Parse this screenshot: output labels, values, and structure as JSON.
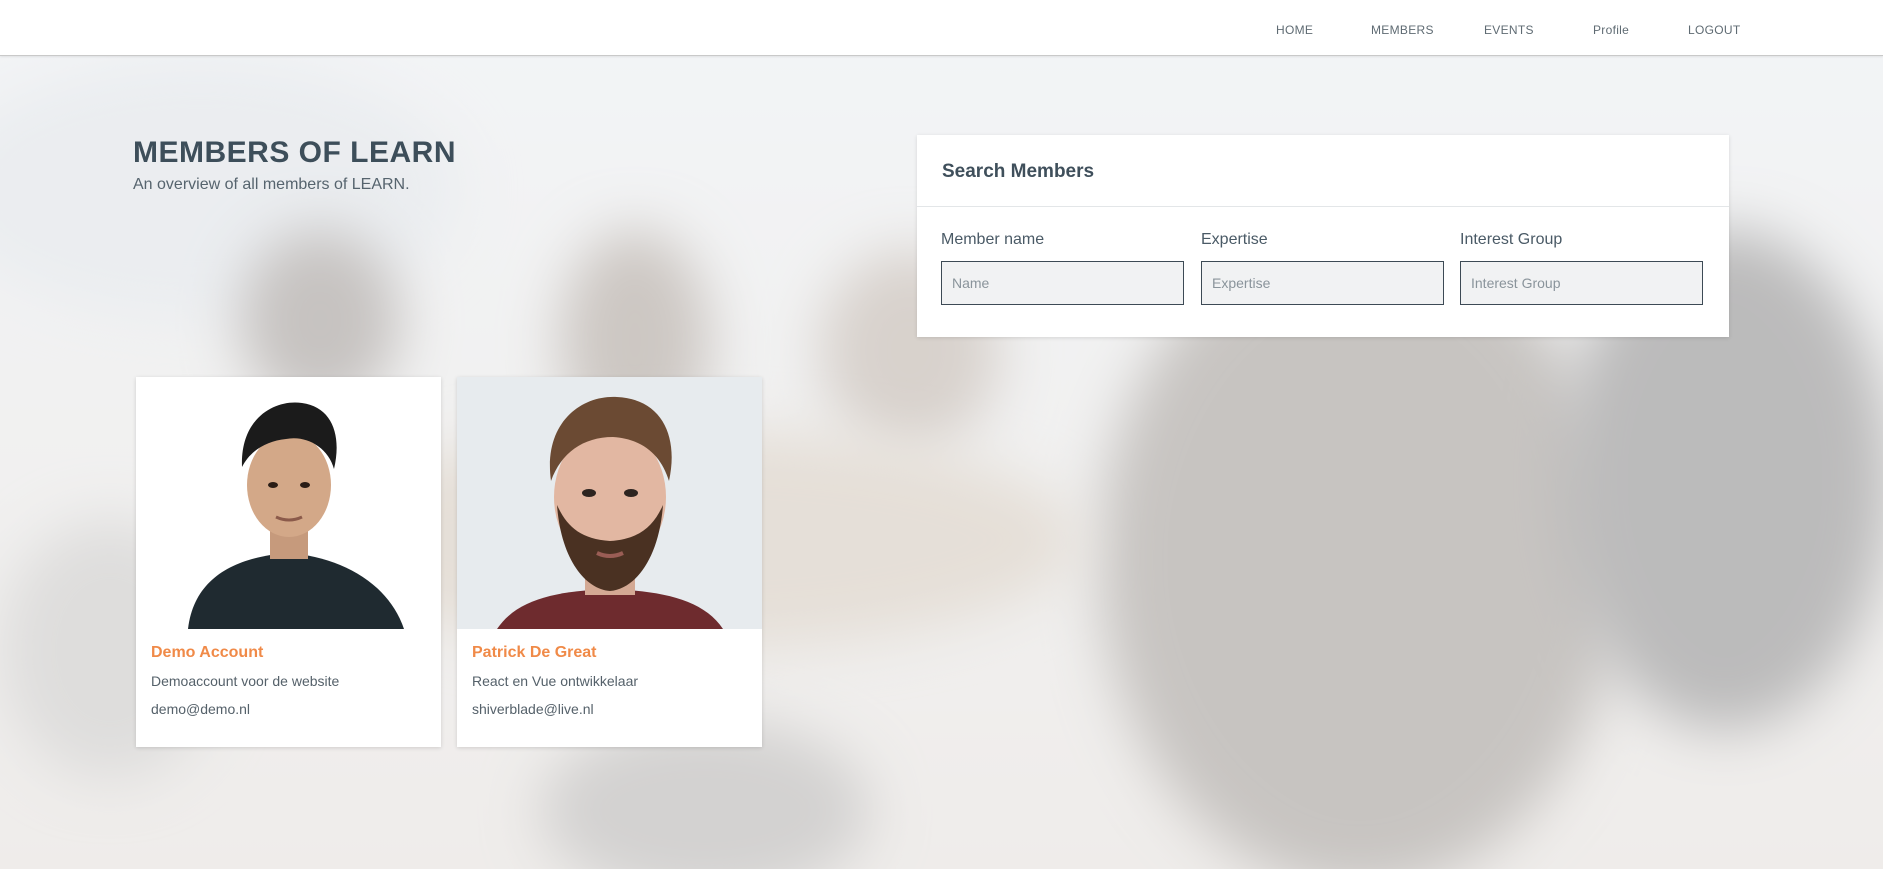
{
  "nav": {
    "items": [
      "HOME",
      "MEMBERS",
      "EVENTS",
      "Profile",
      "LOGOUT"
    ]
  },
  "page": {
    "title": "MEMBERS OF LEARN",
    "subtitle": "An overview of all members of LEARN."
  },
  "search": {
    "title": "Search Members",
    "fields": [
      {
        "label": "Member name",
        "placeholder": "Name",
        "value": ""
      },
      {
        "label": "Expertise",
        "placeholder": "Expertise",
        "value": ""
      },
      {
        "label": "Interest Group",
        "placeholder": "Interest Group",
        "value": ""
      }
    ]
  },
  "members": [
    {
      "name": "Demo Account",
      "description": "Demoaccount voor de website",
      "email": "demo@demo.nl",
      "photo_icon": "person-portrait-icon"
    },
    {
      "name": "Patrick De Great",
      "description": "React en Vue ontwikkelaar",
      "email": "shiverblade@live.nl",
      "photo_icon": "person-portrait-icon"
    }
  ],
  "colors": {
    "accent": "#f08a48",
    "heading": "#3d4e5a",
    "text": "#55616a",
    "input_border": "#3d4a55",
    "nav_bg": "#ffffff"
  }
}
